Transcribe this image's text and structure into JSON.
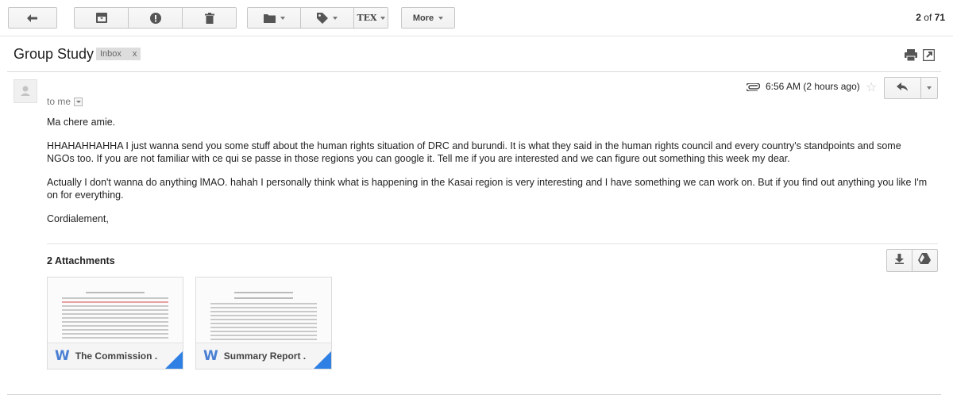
{
  "toolbar": {
    "back_icon": "arrow-left-icon",
    "archive_icon": "archive-icon",
    "spam_icon": "report-spam-icon",
    "delete_icon": "trash-icon",
    "move_icon": "folder-icon",
    "labels_icon": "tag-icon",
    "tex_icon": "tex-icon",
    "tex_label": "TEX",
    "more_label": "More",
    "pager_current": "2",
    "pager_sep": " of ",
    "pager_total": "71"
  },
  "thread": {
    "subject": "Group Study",
    "label": "Inbox",
    "label_remove": "x",
    "print_icon": "print-icon",
    "new_window_icon": "open-in-new-window-icon"
  },
  "message": {
    "recipient": "to me",
    "time": "6:56 AM (2 hours ago)",
    "paragraphs": [
      "Ma chere amie.",
      "HHAHAHHAHHA I just wanna send you some stuff about the human rights situation of DRC and burundi. It is what they said in the human rights council and every country's standpoints and some NGOs too. If you are not familiar with ce qui se passe in those regions you can google it. Tell me if you are interested and we can figure out something this week my dear.",
      "Actually I don't wanna do anything lMAO. hahah I personally think what is happening in the Kasai region is very interesting and I have something we can work on. But if you find out anything you like I'm on for everything.",
      "Cordialement,"
    ]
  },
  "attachments": {
    "title": "2 Attachments",
    "items": [
      {
        "name": "The Commission ...",
        "type_icon": "word-doc-icon"
      },
      {
        "name": "Summary Report ...",
        "type_icon": "word-doc-icon"
      }
    ]
  }
}
